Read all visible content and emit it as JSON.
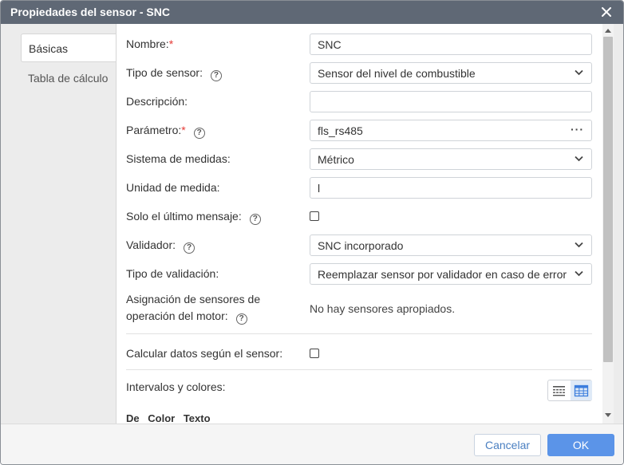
{
  "window": {
    "title": "Propiedades del sensor - SNC"
  },
  "tabs": [
    {
      "label": "Básicas",
      "active": true
    },
    {
      "label": "Tabla de cálculo",
      "active": false
    }
  ],
  "form": {
    "name_label": "Nombre:",
    "name_value": "SNC",
    "type_label": "Tipo de sensor:",
    "type_value": "Sensor del nivel de combustible",
    "description_label": "Descripción:",
    "description_value": "",
    "parameter_label": "Parámetro:",
    "parameter_value": "fls_rs485",
    "measure_system_label": "Sistema de medidas:",
    "measure_system_value": "Métrico",
    "unit_label": "Unidad de medida:",
    "unit_value": "l",
    "last_message_label": "Solo el último mensaje:",
    "last_message_checked": false,
    "validator_label": "Validador:",
    "validator_value": "SNC incorporado",
    "validation_type_label": "Tipo de validación:",
    "validation_type_value": "Reemplazar sensor por validador en caso de error",
    "engine_sensors_label_line1": "Asignación de sensores de",
    "engine_sensors_label_line2": "operación del motor:",
    "engine_sensors_value": "No hay sensores apropiados.",
    "calc_by_sensor_label": "Calcular datos según el sensor:",
    "calc_by_sensor_checked": false,
    "intervals_label": "Intervalos y colores:",
    "columns": [
      "De",
      "Color",
      "Texto"
    ]
  },
  "footer": {
    "cancel_label": "Cancelar",
    "ok_label": "OK"
  },
  "colors": {
    "titlebar": "#5f6875",
    "primary": "#5b94e8",
    "required": "#e53935"
  }
}
